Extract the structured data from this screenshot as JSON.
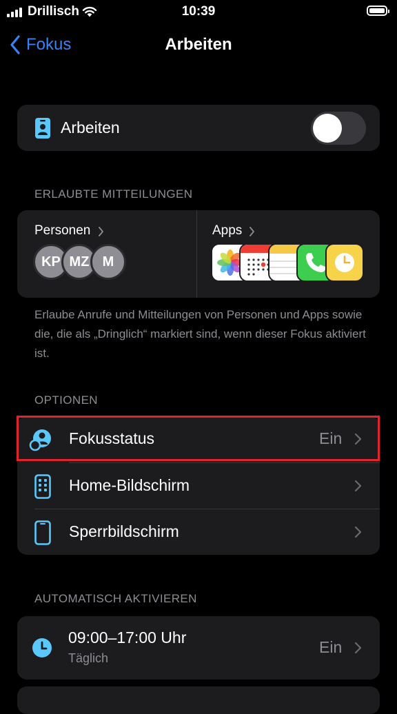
{
  "status_bar": {
    "carrier": "Drillisch",
    "time": "10:39"
  },
  "nav": {
    "back_label": "Fokus",
    "title": "Arbeiten"
  },
  "focus_toggle": {
    "label": "Arbeiten",
    "enabled": false
  },
  "allowed": {
    "header": "ERLAUBTE MITTEILUNGEN",
    "people_label": "Personen",
    "people": [
      "KP",
      "MZ",
      "M"
    ],
    "apps_label": "Apps",
    "apps": [
      "photos-app-icon",
      "calendar-app-icon",
      "notes-app-icon",
      "phone-app-icon",
      "clock-app-icon"
    ],
    "footer": "Erlaube Anrufe und Mitteilungen von Personen und Apps sowie die, die als „Dringlich“ markiert sind, wenn dieser Fokus aktiviert ist."
  },
  "options": {
    "header": "OPTIONEN",
    "items": [
      {
        "label": "Fokusstatus",
        "value": "Ein",
        "icon": "focus-status-icon"
      },
      {
        "label": "Home-Bildschirm",
        "value": "",
        "icon": "home-screen-icon"
      },
      {
        "label": "Sperrbildschirm",
        "value": "",
        "icon": "lock-screen-icon"
      }
    ]
  },
  "automation": {
    "header": "AUTOMATISCH AKTIVIEREN",
    "items": [
      {
        "title": "09:00–17:00 Uhr",
        "subtitle": "Täglich",
        "value": "Ein",
        "icon": "clock-icon"
      }
    ]
  },
  "colors": {
    "accent": "#3a82f7",
    "icon_blue": "#5ac8fa",
    "highlight": "#e0242b"
  }
}
